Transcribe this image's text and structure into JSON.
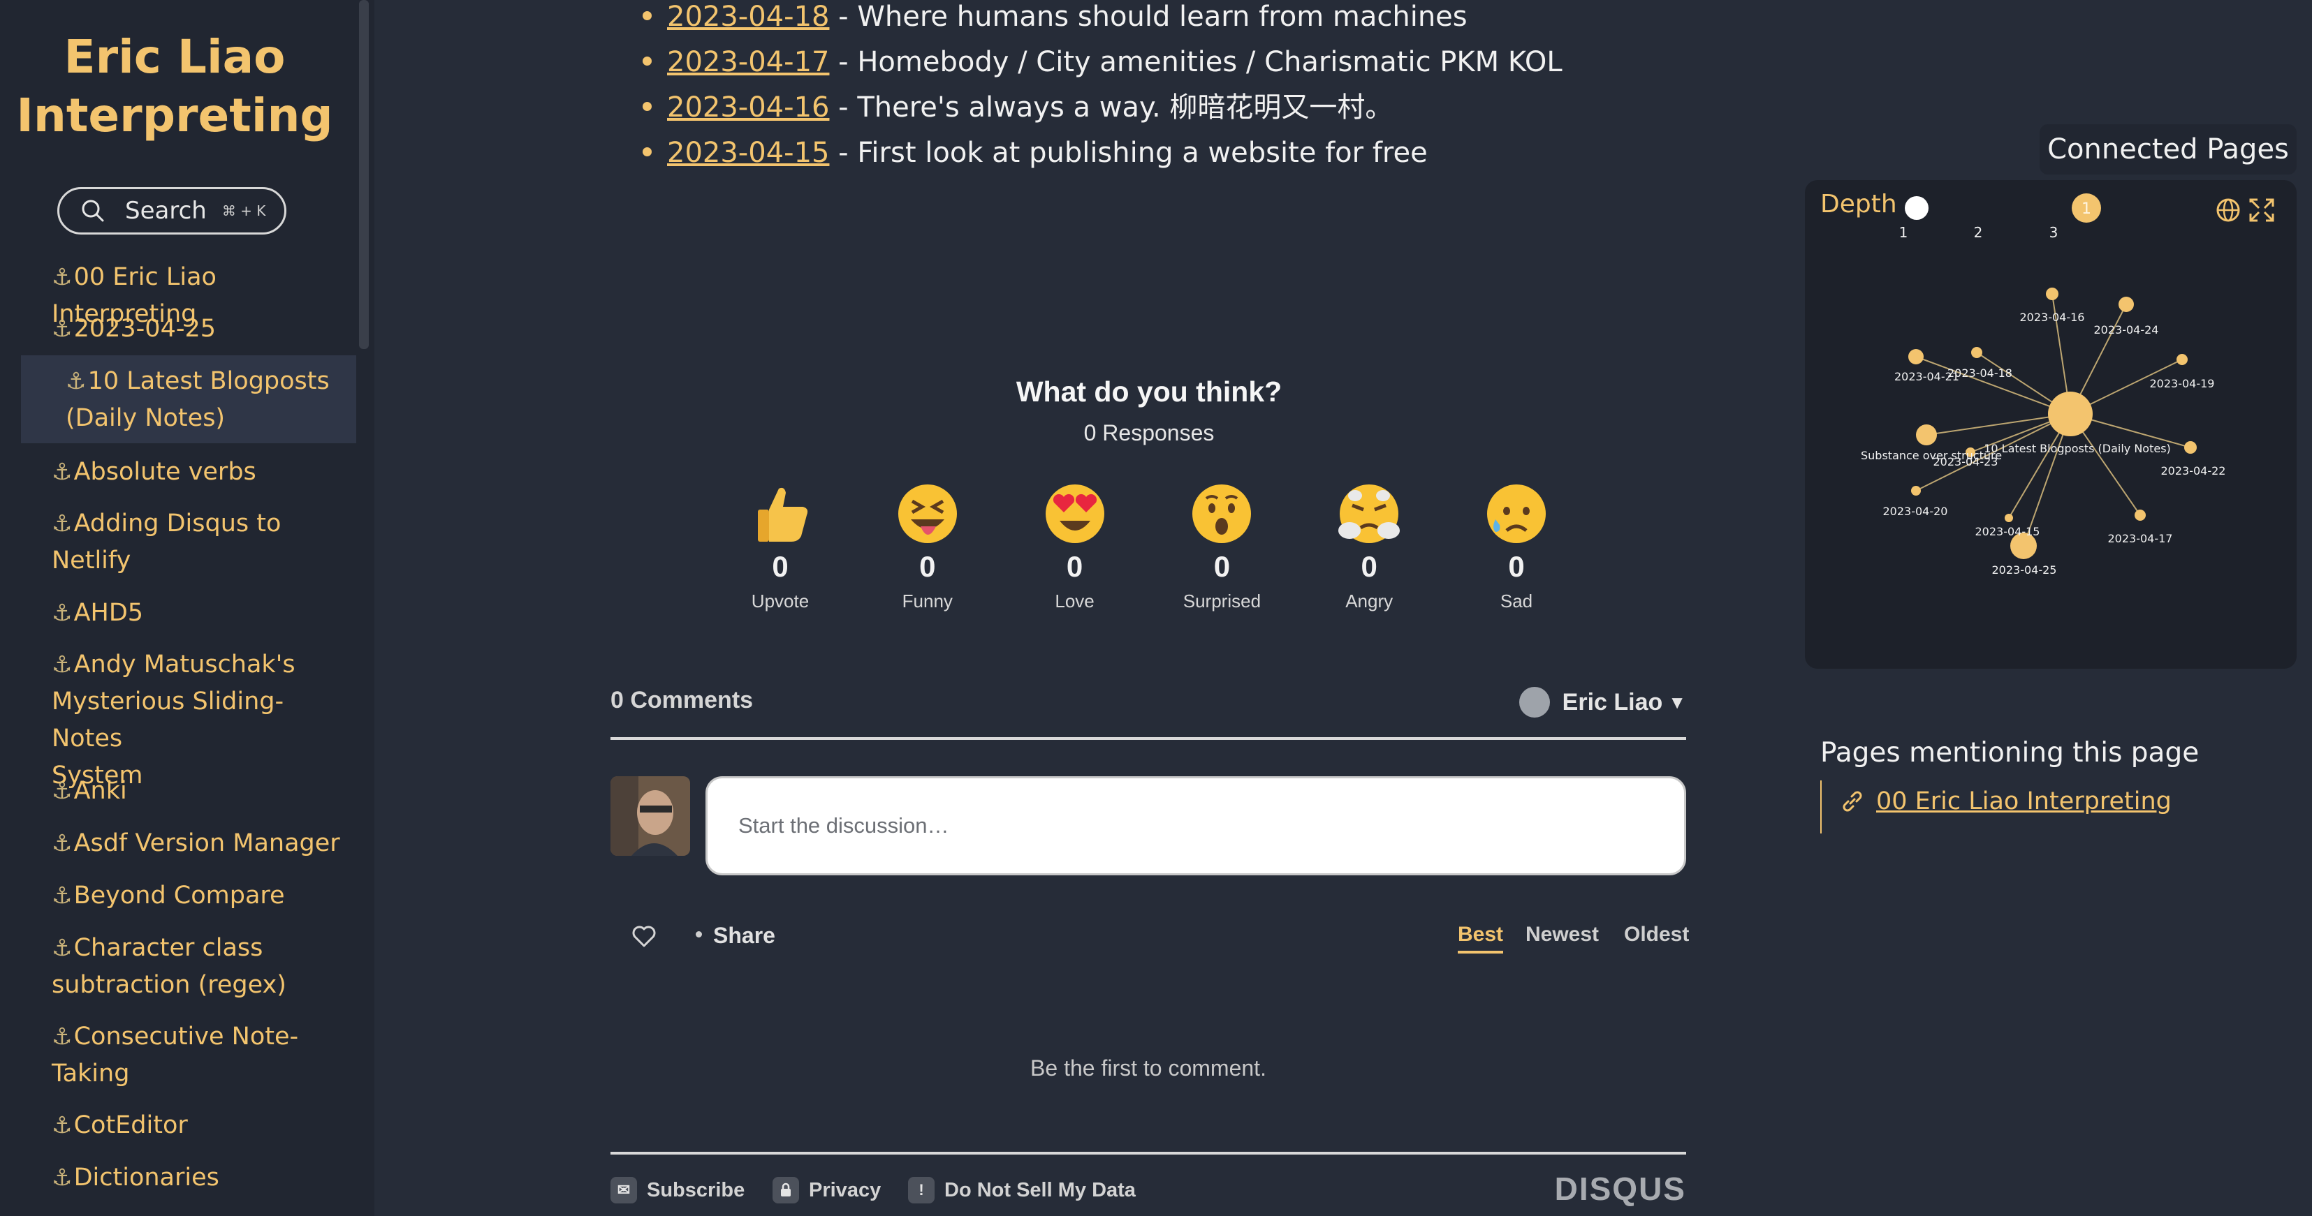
{
  "site": {
    "title_line1": "Eric Liao",
    "title_line2": "Interpreting"
  },
  "search": {
    "label": "Search",
    "shortcut": "⌘ + K"
  },
  "sidebar": {
    "items": [
      {
        "label": "00 Eric Liao Interpreting",
        "lines": [
          "00 Eric Liao Interpreting"
        ]
      },
      {
        "label": "2023-04-25",
        "lines": [
          "2023-04-25"
        ]
      },
      {
        "label": "10 Latest Blogposts (Daily Notes)",
        "lines": [
          "10 Latest Blogposts",
          "(Daily Notes)"
        ],
        "active": true
      },
      {
        "label": "Absolute verbs",
        "lines": [
          "Absolute verbs"
        ]
      },
      {
        "label": "Adding Disqus to Netlify",
        "lines": [
          "Adding Disqus to",
          "Netlify"
        ]
      },
      {
        "label": "AHD5",
        "lines": [
          "AHD5"
        ]
      },
      {
        "label": "Andy Matuschak's Mysterious Sliding-Notes System",
        "lines": [
          "Andy Matuschak's",
          "Mysterious Sliding-Notes",
          "System"
        ]
      },
      {
        "label": "Anki",
        "lines": [
          "Anki"
        ]
      },
      {
        "label": "Asdf Version Manager",
        "lines": [
          "Asdf Version Manager"
        ]
      },
      {
        "label": "Beyond Compare",
        "lines": [
          "Beyond Compare"
        ]
      },
      {
        "label": "Character class subtraction (regex)",
        "lines": [
          "Character class",
          "subtraction (regex)"
        ]
      },
      {
        "label": "Consecutive Note-Taking",
        "lines": [
          "Consecutive Note-",
          "Taking"
        ]
      },
      {
        "label": "CotEditor",
        "lines": [
          "CotEditor"
        ]
      },
      {
        "label": "Dictionaries",
        "lines": [
          "Dictionaries"
        ]
      }
    ]
  },
  "posts": [
    {
      "date": "2023-04-18",
      "title": " - Where humans should learn from machines"
    },
    {
      "date": "2023-04-17",
      "title": " - Homebody / City amenities / Charismatic PKM KOL"
    },
    {
      "date": "2023-04-16",
      "title": " - There's always a way. 柳暗花明又一村。"
    },
    {
      "date": "2023-04-15",
      "title": " - First look at publishing a website for free"
    }
  ],
  "disqus": {
    "reactions_title": "What do you think?",
    "responses": "0 Responses",
    "reactions": [
      {
        "name": "Upvote",
        "count": "0",
        "icon": "thumbs-up-emoji"
      },
      {
        "name": "Funny",
        "count": "0",
        "icon": "squinting-tongue-emoji"
      },
      {
        "name": "Love",
        "count": "0",
        "icon": "heart-eyes-emoji"
      },
      {
        "name": "Surprised",
        "count": "0",
        "icon": "surprised-emoji"
      },
      {
        "name": "Angry",
        "count": "0",
        "icon": "steam-nose-emoji"
      },
      {
        "name": "Sad",
        "count": "0",
        "icon": "sad-sweat-emoji"
      }
    ],
    "comments_count": "0 Comments",
    "user": "Eric Liao",
    "input_placeholder": "Start the discussion…",
    "share": "Share",
    "sort": [
      "Best",
      "Newest",
      "Oldest"
    ],
    "sort_selected": "Best",
    "empty": "Be the first to comment.",
    "footer": {
      "subscribe": "Subscribe",
      "privacy": "Privacy",
      "do_not_sell": "Do Not Sell My Data",
      "brand": "DISQUS"
    }
  },
  "graph": {
    "title": "Connected Pages",
    "depth_label": "Depth",
    "depth_ticks": [
      "1",
      "2",
      "3"
    ],
    "depth_value": "1",
    "nodes": [
      {
        "id": "center",
        "label": "10 Latest Blogposts (Daily Notes)"
      },
      {
        "id": "n16",
        "label": "2023-04-16"
      },
      {
        "id": "n24",
        "label": "2023-04-24"
      },
      {
        "id": "n21",
        "label": "2023-04-21"
      },
      {
        "id": "n18",
        "label": "2023-04-18"
      },
      {
        "id": "n19",
        "label": "2023-04-19"
      },
      {
        "id": "sub",
        "label": "Substance over structure"
      },
      {
        "id": "n23",
        "label": "2023-04-23"
      },
      {
        "id": "n22",
        "label": "2023-04-22"
      },
      {
        "id": "n20",
        "label": "2023-04-20"
      },
      {
        "id": "n15",
        "label": "2023-04-15"
      },
      {
        "id": "n17",
        "label": "2023-04-17"
      },
      {
        "id": "n25",
        "label": "2023-04-25"
      }
    ]
  },
  "mentions": {
    "title": "Pages mentioning this page",
    "items": [
      {
        "label": "00 Eric Liao Interpreting"
      }
    ]
  },
  "colors": {
    "accent": "#f3c46e",
    "background": "#262c38",
    "sidebar": "#212631",
    "panel": "#1d212a"
  }
}
